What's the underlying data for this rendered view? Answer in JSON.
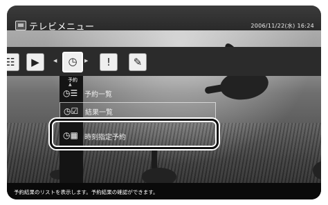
{
  "window": {
    "title": "テレビメニュー",
    "datetime": "2006/11/22(水) 16:24"
  },
  "toolbar": {
    "items": [
      {
        "icon": "list-icon",
        "glyph": "☷"
      },
      {
        "icon": "recording-list-icon",
        "glyph": "▶"
      },
      {
        "icon": "reservation-icon",
        "glyph": "◷"
      },
      {
        "icon": "info-icon",
        "glyph": "!"
      },
      {
        "icon": "wrench-icon",
        "glyph": "✎"
      }
    ],
    "selected_label": "予約"
  },
  "menu": {
    "items": [
      {
        "label": "予約一覧",
        "icon": "clock-list-icon"
      },
      {
        "label": "結果一覧",
        "icon": "clock-check-icon"
      },
      {
        "label": "時刻指定予約",
        "icon": "clock-keypad-icon"
      }
    ]
  },
  "status": {
    "text": "予約結果のリストを表示します。予約結果の確認ができます。"
  }
}
